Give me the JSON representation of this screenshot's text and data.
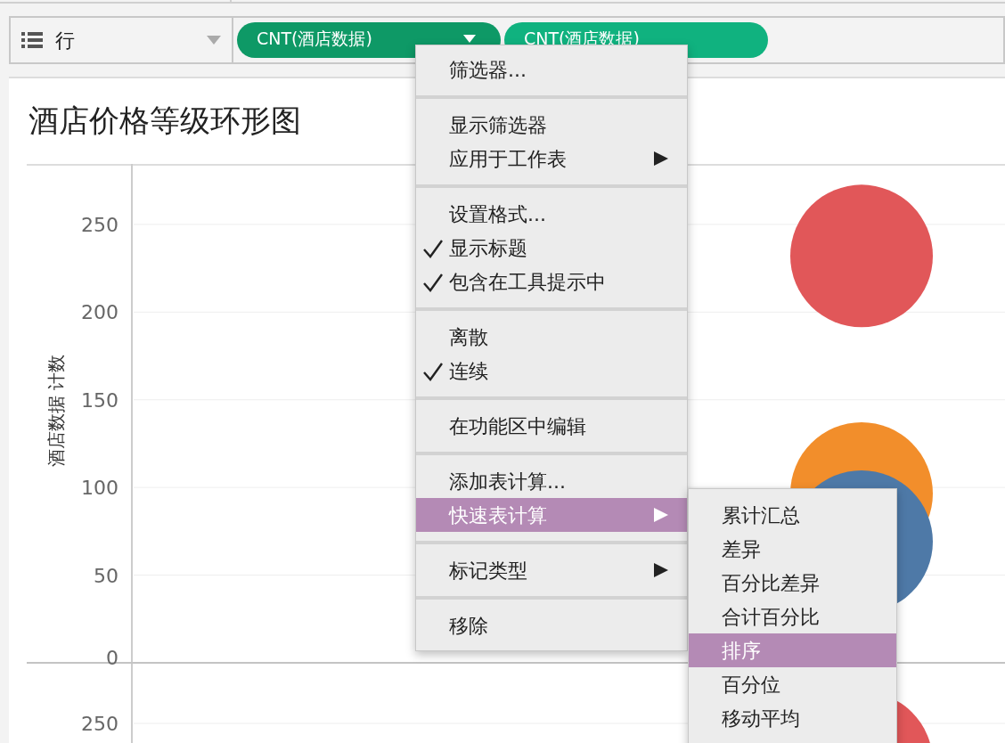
{
  "shelf": {
    "label": "行",
    "pills": [
      {
        "text": "CNT(酒店数据)",
        "selected": true
      },
      {
        "text": "CNT(酒店数据)",
        "selected": false
      }
    ]
  },
  "view": {
    "title": "酒店价格等级环形图",
    "chart_data": {
      "type": "scatter",
      "ylabel": "酒店数据 计数",
      "yticks": [
        0,
        50,
        100,
        150,
        200,
        250
      ],
      "ylim": [
        0,
        284
      ],
      "grid": true,
      "series": [
        {
          "color": "#e15759",
          "values": [
            232
          ]
        },
        {
          "color": "#f28e2b",
          "values": [
            null
          ]
        },
        {
          "color": "#4e79a7",
          "values": [
            null
          ]
        }
      ]
    },
    "lower_pane": {
      "ytick_labels": [
        "250"
      ]
    }
  },
  "context_menu": {
    "items": [
      {
        "kind": "item",
        "label": "筛选器...",
        "checked": false,
        "submenu": false,
        "selected": false
      },
      {
        "kind": "separator"
      },
      {
        "kind": "item",
        "label": "显示筛选器",
        "checked": false,
        "submenu": false,
        "selected": false
      },
      {
        "kind": "item",
        "label": "应用于工作表",
        "checked": false,
        "submenu": true,
        "selected": false
      },
      {
        "kind": "separator"
      },
      {
        "kind": "item",
        "label": "设置格式...",
        "checked": false,
        "submenu": false,
        "selected": false
      },
      {
        "kind": "item",
        "label": "显示标题",
        "checked": true,
        "submenu": false,
        "selected": false
      },
      {
        "kind": "item",
        "label": "包含在工具提示中",
        "checked": true,
        "submenu": false,
        "selected": false
      },
      {
        "kind": "separator"
      },
      {
        "kind": "item",
        "label": "离散",
        "checked": false,
        "submenu": false,
        "selected": false
      },
      {
        "kind": "item",
        "label": "连续",
        "checked": true,
        "submenu": false,
        "selected": false
      },
      {
        "kind": "separator"
      },
      {
        "kind": "item",
        "label": "在功能区中编辑",
        "checked": false,
        "submenu": false,
        "selected": false
      },
      {
        "kind": "separator"
      },
      {
        "kind": "item",
        "label": "添加表计算...",
        "checked": false,
        "submenu": false,
        "selected": false
      },
      {
        "kind": "item",
        "label": "快速表计算",
        "checked": false,
        "submenu": true,
        "selected": true
      },
      {
        "kind": "separator"
      },
      {
        "kind": "item",
        "label": "标记类型",
        "checked": false,
        "submenu": true,
        "selected": false
      },
      {
        "kind": "separator"
      },
      {
        "kind": "item",
        "label": "移除",
        "checked": false,
        "submenu": false,
        "selected": false
      }
    ]
  },
  "submenu": {
    "items": [
      {
        "label": "累计汇总",
        "selected": false
      },
      {
        "label": "差异",
        "selected": false
      },
      {
        "label": "百分比差异",
        "selected": false
      },
      {
        "label": "合计百分比",
        "selected": false
      },
      {
        "label": "排序",
        "selected": true
      },
      {
        "label": "百分位",
        "selected": false
      },
      {
        "label": "移动平均",
        "selected": false
      }
    ]
  }
}
